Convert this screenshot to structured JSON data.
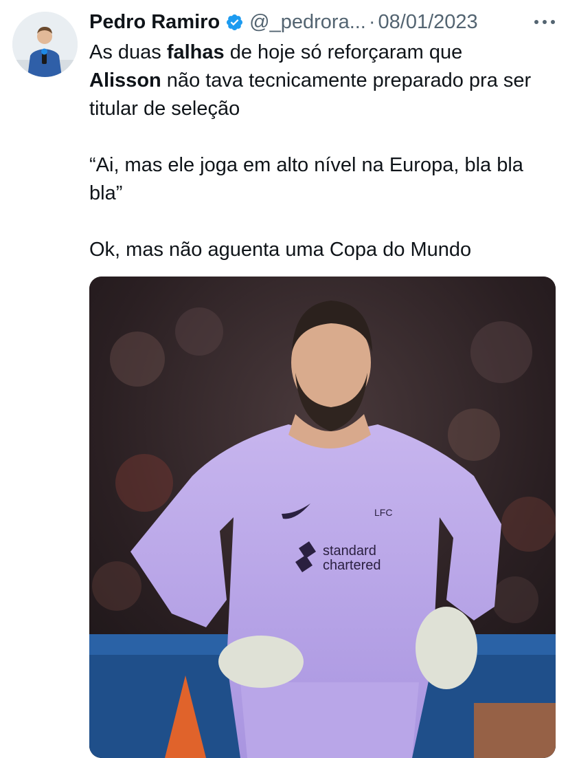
{
  "author": {
    "name": "Pedro Ramiro",
    "handle": "@_pedrora...",
    "separator": "·",
    "date": "08/01/2023",
    "verified": true
  },
  "tweet": {
    "line1_before": "As duas ",
    "line1_bold": "falhas",
    "line1_after": " de hoje só reforçaram que",
    "line2_bold": "Alisson",
    "line2_after": " não tava tecnicamente preparado pra ser titular de seleção",
    "quote": "“Ai, mas ele joga em alto nível na Europa, bla bla bla”",
    "closing": "Ok, mas não aguenta uma Copa do Mundo"
  },
  "media": {
    "description_icon": "photo-goalkeeper-icon",
    "jersey_text_1": "standard",
    "jersey_text_2": "chartered",
    "crest": "LFC"
  },
  "colors": {
    "accent": "#1d9bf0",
    "secondary_text": "#536471",
    "primary_text": "#0f1419",
    "jersey": "#b9a6e8"
  }
}
